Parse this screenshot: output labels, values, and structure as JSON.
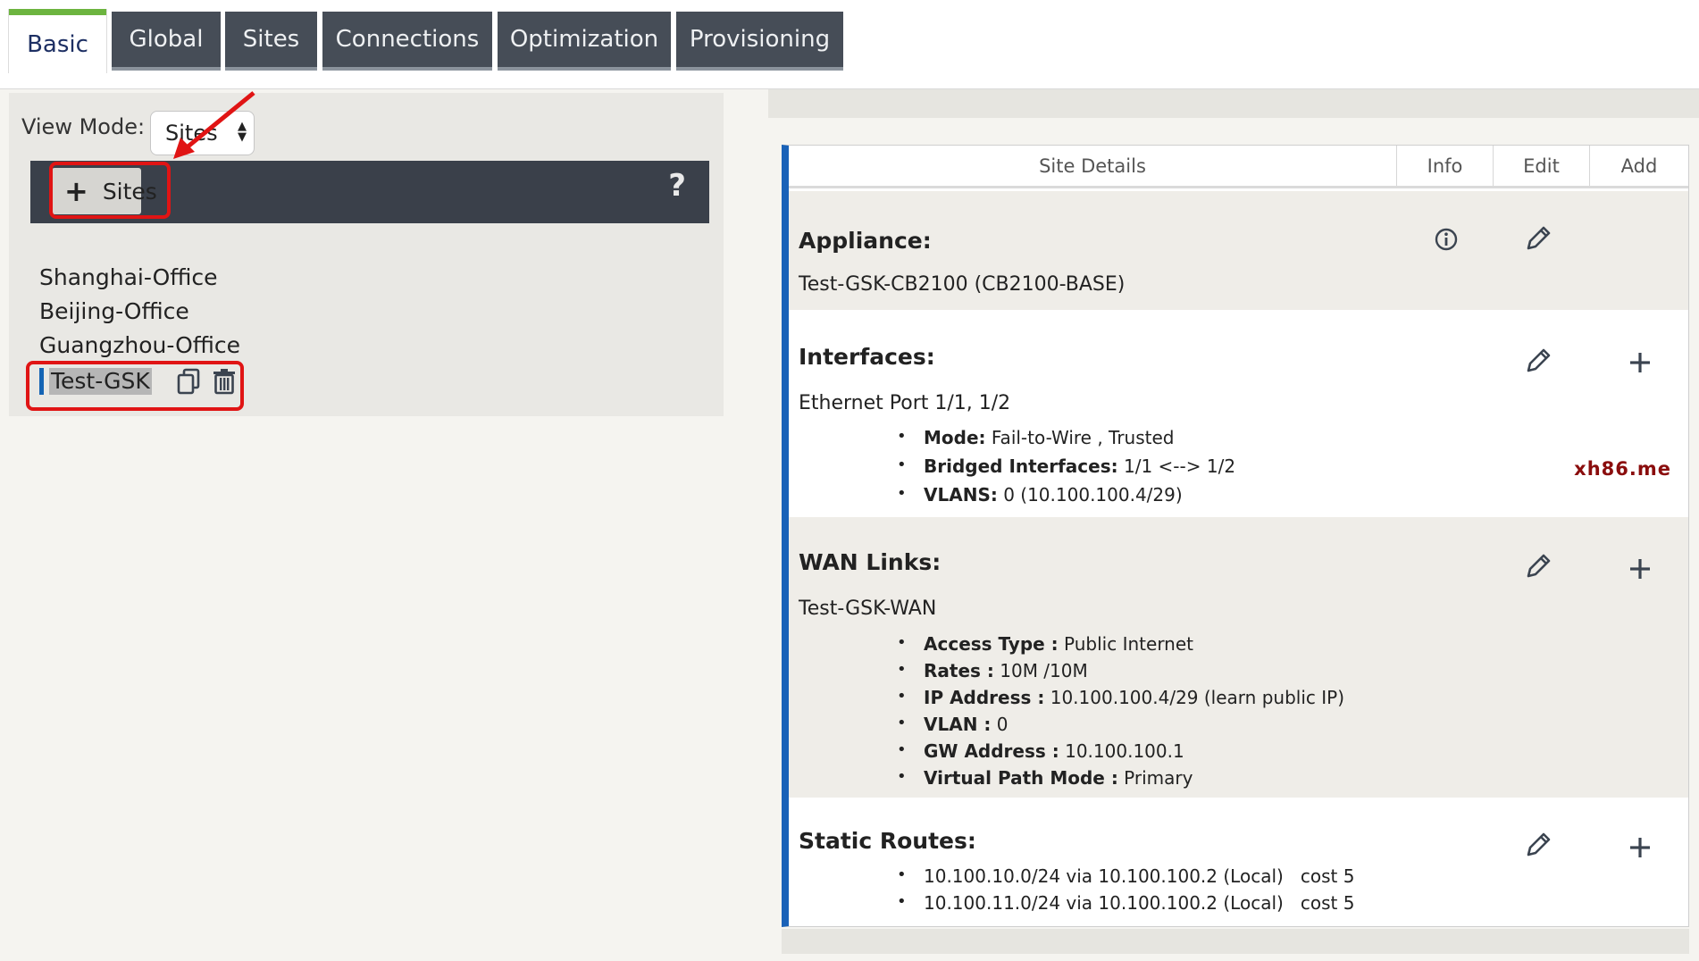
{
  "tabs": {
    "basic": "Basic",
    "global": "Global",
    "sites": "Sites",
    "connections": "Connections",
    "optimization": "Optimization",
    "provisioning": "Provisioning"
  },
  "left": {
    "view_mode_label": "View Mode:",
    "view_mode_value": "Sites",
    "add_sites_label": "Sites",
    "help": "?",
    "sites": [
      "Shanghai-Office",
      "Beijing-Office",
      "Guangzhou-Office"
    ],
    "selected_site": "Test-GSK"
  },
  "details": {
    "header": {
      "site_details": "Site Details",
      "info": "Info",
      "edit": "Edit",
      "add": "Add"
    },
    "appliance": {
      "title": "Appliance:",
      "value": "Test-GSK-CB2100 (CB2100-BASE)"
    },
    "interfaces": {
      "title": "Interfaces:",
      "value": "Ethernet Port 1/1, 1/2",
      "bullets": [
        {
          "k": "Mode:",
          "v": " Fail-to-Wire , Trusted"
        },
        {
          "k": "Bridged Interfaces:",
          "v": " 1/1 <--> 1/2"
        },
        {
          "k": "VLANS:",
          "v": " 0 (10.100.100.4/29)"
        }
      ],
      "watermark": "xh86.me"
    },
    "wan": {
      "title": "WAN Links:",
      "value": "Test-GSK-WAN",
      "bullets": [
        {
          "k": "Access Type :",
          "v": " Public Internet"
        },
        {
          "k": "Rates :",
          "v": " 10M /10M"
        },
        {
          "k": "IP Address :",
          "v": " 10.100.100.4/29 (learn public IP)"
        },
        {
          "k": "VLAN :",
          "v": " 0"
        },
        {
          "k": "GW Address :",
          "v": " 10.100.100.1"
        },
        {
          "k": "Virtual Path Mode :",
          "v": " Primary"
        }
      ]
    },
    "routes": {
      "title": "Static Routes:",
      "items": [
        "10.100.10.0/24 via 10.100.100.2 (Local)   cost 5",
        "10.100.11.0/24 via 10.100.100.2 (Local)   cost 5"
      ]
    }
  },
  "colors": {
    "tab_dark": "#464d57",
    "tab_active_accent": "#6cb43f",
    "details_accent": "#1a62b8",
    "annotation_red": "#e01414",
    "watermark": "#8a0d0d"
  },
  "icons": {
    "info": "info-icon",
    "edit": "pencil-icon",
    "add": "plus-icon",
    "copy": "copy-icon",
    "delete": "trash-icon"
  }
}
